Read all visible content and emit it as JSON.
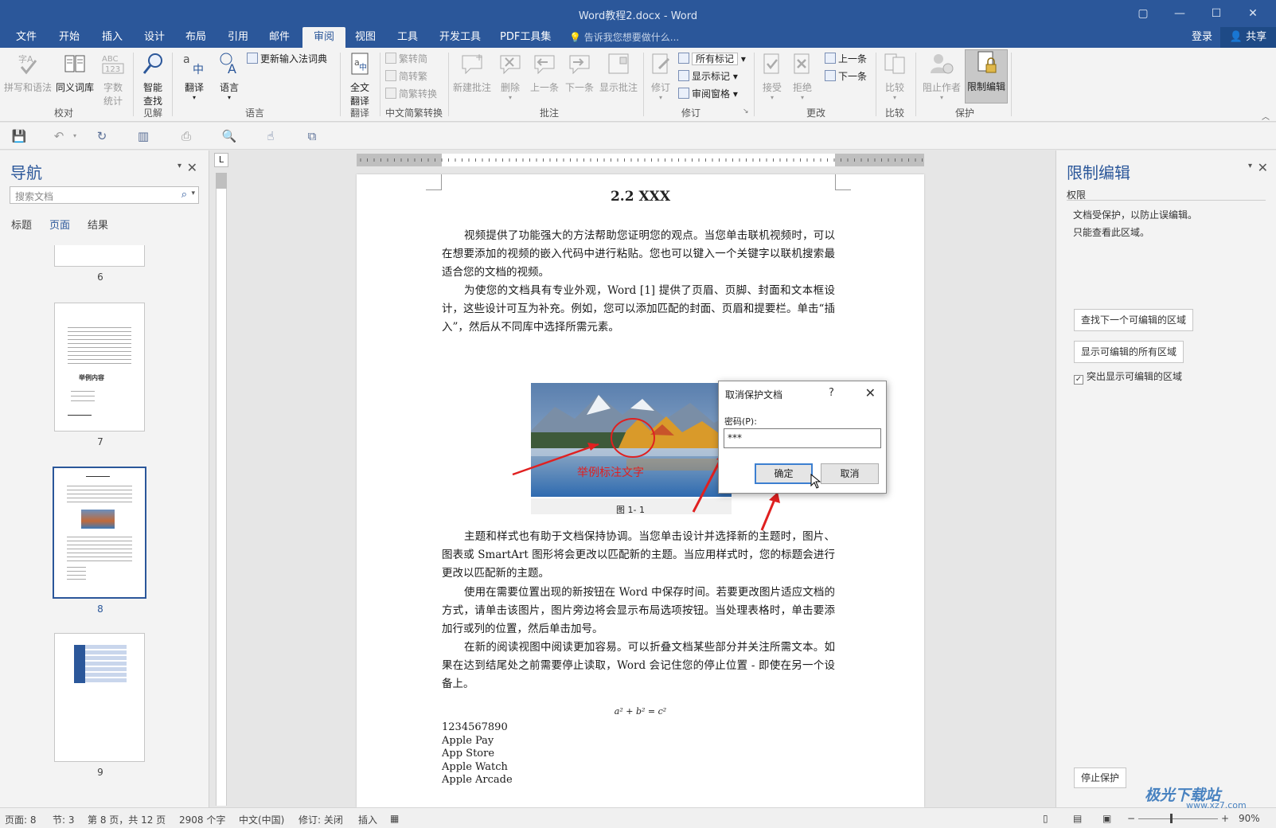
{
  "window": {
    "title": "Word教程2.docx - Word",
    "controls": [
      "▢",
      "—",
      "☐",
      "✕"
    ]
  },
  "tabs": [
    {
      "label": "文件"
    },
    {
      "label": "开始"
    },
    {
      "label": "插入"
    },
    {
      "label": "设计"
    },
    {
      "label": "布局"
    },
    {
      "label": "引用"
    },
    {
      "label": "邮件"
    },
    {
      "label": "审阅",
      "active": true
    },
    {
      "label": "视图"
    },
    {
      "label": "工具"
    },
    {
      "label": "开发工具"
    },
    {
      "label": "PDF工具集"
    }
  ],
  "tell_me": "告诉我您想要做什么...",
  "account": {
    "login": "登录",
    "share": "共享"
  },
  "ribbon": {
    "proofing": {
      "spell": "拼写和语法",
      "thesaurus": "同义词库",
      "wordcount_line1": "字数",
      "wordcount_line2": "统计",
      "label": "校对"
    },
    "insights": {
      "smart_line1": "智能",
      "smart_line2": "查找",
      "label": "见解"
    },
    "language": {
      "translate": "翻译",
      "lang": "语言",
      "update_ime": "更新输入法词典",
      "label": "语言"
    },
    "translation": {
      "full_line1": "全文",
      "full_line2": "翻译",
      "label": "翻译"
    },
    "chinese": {
      "to_trad": "繁转简",
      "to_simp": "简转繁",
      "convert": "简繁转换",
      "label": "中文简繁转换"
    },
    "comments": {
      "new": "新建批注",
      "delete": "删除",
      "prev": "上一条",
      "next": "下一条",
      "show": "显示批注",
      "label": "批注"
    },
    "tracking": {
      "track": "修订",
      "markup": "所有标记",
      "show_markup": "显示标记",
      "pane": "审阅窗格",
      "label": "修订"
    },
    "changes": {
      "accept": "接受",
      "reject": "拒绝",
      "prev": "上一条",
      "next": "下一条",
      "label": "更改"
    },
    "compare": {
      "compare": "比较",
      "label": "比较"
    },
    "protect": {
      "block": "阻止作者",
      "restrict": "限制编辑",
      "label": "保护"
    }
  },
  "nav": {
    "title": "导航",
    "search_placeholder": "搜索文档",
    "tabs": [
      "标题",
      "页面",
      "结果"
    ],
    "active_tab": "页面",
    "pages": [
      "6",
      "7",
      "8",
      "9"
    ],
    "selected_page": "8",
    "thumb7_heading": "举例内容"
  },
  "document": {
    "heading": "2.2 XXX",
    "paragraphs": [
      "视频提供了功能强大的方法帮助您证明您的观点。当您单击联机视频时，可以在想要添加的视频的嵌入代码中进行粘贴。您也可以键入一个关键字以联机搜索最适合您的文档的视频。",
      "为使您的文档具有专业外观，Word [1] 提供了页眉、页脚、封面和文本框设计，这些设计可互为补充。例如，您可以添加匹配的封面、页眉和提要栏。单击“插入”，然后从不同库中选择所需元素。",
      "主题和样式也有助于文档保持协调。当您单击设计并选择新的主题时，图片、图表或 SmartArt 图形将会更改以匹配新的主题。当应用样式时，您的标题会进行更改以匹配新的主题。",
      "使用在需要位置出现的新按钮在 Word 中保存时间。若要更改图片适应文档的方式，请单击该图片，图片旁边将会显示布局选项按钮。当处理表格时，单击要添加行或列的位置，然后单击加号。",
      "在新的阅读视图中阅读更加容易。可以折叠文档某些部分并关注所需文本。如果在达到结尾处之前需要停止读取，Word 会记住您的停止位置 - 即使在另一个设备上。"
    ],
    "image_annotation": "举例标注文字",
    "caption": "图 1- 1",
    "formula": "a² + b² = c²",
    "list": [
      "1234567890",
      "Apple Pay",
      "App Store",
      "Apple Watch",
      "Apple Arcade"
    ]
  },
  "dialog": {
    "title": "取消保护文档",
    "help": "?",
    "close": "✕",
    "password_label": "密码(P):",
    "password_value": "***",
    "ok": "确定",
    "cancel": "取消"
  },
  "restrict_pane": {
    "title": "限制编辑",
    "section": "权限",
    "desc1": "文档受保护，以防止误编辑。",
    "desc2": "只能查看此区域。",
    "find_next": "查找下一个可编辑的区域",
    "show_all": "显示可编辑的所有区域",
    "highlight": "突出显示可编辑的区域",
    "highlight_checked": true,
    "stop": "停止保护"
  },
  "status": {
    "page": "页面: 8",
    "section": "节: 3",
    "page_of": "第 8 页，共 12 页",
    "words": "2908 个字",
    "lang": "中文(中国)",
    "track": "修订: 关闭",
    "insert": "插入",
    "zoom": "90%"
  },
  "watermark": {
    "brand": "极光下载站",
    "url": "www.xz7.com"
  },
  "colors": {
    "accent": "#2b579a",
    "annotation": "#e02020"
  }
}
